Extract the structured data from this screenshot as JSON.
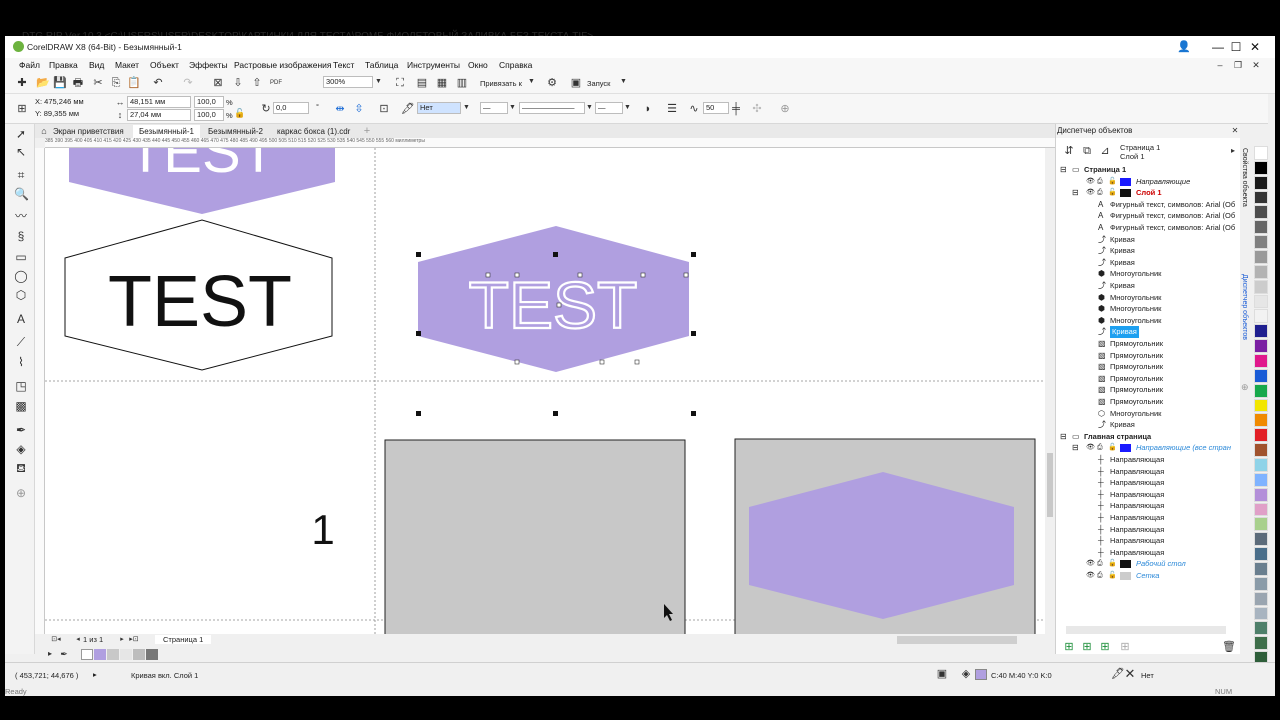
{
  "topbar": {
    "ghost_title": "DTG RIP Ver.10.3 <C:\\USERS\\USER\\DESKTOP\\КАРТИНКИ ДЛЯ ТЕСТА\\РОМБ ФИОЛЕТОВЫЙ ЗАЛИВКА БЕЗ ТЕКСТА.TIF>"
  },
  "window": {
    "title": "CorelDRAW X8 (64-Bit) - Безымянный-1",
    "minimize": "—",
    "maximize": "☐",
    "close": "✕",
    "min_inner": "–",
    "max_inner": "❐",
    "close_inner": "✕"
  },
  "menu": [
    "Файл",
    "Правка",
    "Вид",
    "Макет",
    "Объект",
    "Эффекты",
    "Растровые изображения",
    "Текст",
    "Таблица",
    "Инструменты",
    "Окно",
    "Справка"
  ],
  "toolbar": {
    "zoom": "300%",
    "snap_label": "Привязать к",
    "launch_label": "Запуск"
  },
  "props": {
    "x": "X: 475,246 мм",
    "y": "Y: 89,355 мм",
    "w": "48,151 мм",
    "h": "27,04 мм",
    "sx": "100,0",
    "sy": "100,0",
    "pct": "%",
    "angle": "0,0",
    "degree": "°",
    "fill_none": "Нет",
    "smooth_val": "50"
  },
  "doc_tabs": [
    "Экран приветствия",
    "Безымянный-1",
    "Безымянный-2",
    "каркас бокса (1).cdr"
  ],
  "ruler_h": "385   390   395   400   405   410   415   420   425   430   435   440   445   450   455   460   465   470   475   480   485   490   495   500   505   510   515   520   525   530   535   540   545   550   555   560   миллиметры",
  "canvas": {
    "top_test": "TEST",
    "hex_test": "TEST",
    "purple_test": "TEST",
    "page_number": "1",
    "purple": "#b09fe0"
  },
  "page_nav": {
    "pages": "1  из  1",
    "page_tab": "Страница 1"
  },
  "docker": {
    "title": "Диспетчер объектов",
    "page": "Страница 1",
    "layer": "Слой 1",
    "rows": [
      {
        "text": "Страница 1",
        "indent": 0,
        "style": "bold"
      },
      {
        "text": "Направляющие",
        "indent": 1,
        "style": "italic",
        "swatch": "#1a1aff"
      },
      {
        "text": "Слой 1",
        "indent": 1,
        "style": "boldred",
        "swatch": "#111111"
      },
      {
        "text": "Фигурный текст, символов: Arial (Об",
        "indent": 2,
        "icon": "A"
      },
      {
        "text": "Фигурный текст, символов: Arial (Об",
        "indent": 2,
        "icon": "A"
      },
      {
        "text": "Фигурный текст, символов: Arial (Об",
        "indent": 2,
        "icon": "A"
      },
      {
        "text": "Кривая",
        "indent": 2,
        "icon": "curve"
      },
      {
        "text": "Кривая",
        "indent": 2,
        "icon": "curve"
      },
      {
        "text": "Кривая",
        "indent": 2,
        "icon": "curve"
      },
      {
        "text": "Многоугольник",
        "indent": 2,
        "icon": "poly"
      },
      {
        "text": "Кривая",
        "indent": 2,
        "icon": "curve"
      },
      {
        "text": "Многоугольник",
        "indent": 2,
        "icon": "poly"
      },
      {
        "text": "Многоугольник",
        "indent": 2,
        "icon": "poly"
      },
      {
        "text": "Многоугольник",
        "indent": 2,
        "icon": "poly"
      },
      {
        "text": "Кривая",
        "indent": 2,
        "icon": "curve",
        "selected": true
      },
      {
        "text": "Прямоугольник",
        "indent": 2,
        "icon": "rect"
      },
      {
        "text": "Прямоугольник",
        "indent": 2,
        "icon": "rect"
      },
      {
        "text": "Прямоугольник",
        "indent": 2,
        "icon": "rect"
      },
      {
        "text": "Прямоугольник",
        "indent": 2,
        "icon": "rect"
      },
      {
        "text": "Прямоугольник",
        "indent": 2,
        "icon": "rect"
      },
      {
        "text": "Прямоугольник",
        "indent": 2,
        "icon": "rect"
      },
      {
        "text": "Многоугольник",
        "indent": 2,
        "icon": "polyo"
      },
      {
        "text": "Кривая",
        "indent": 2,
        "icon": "curve"
      },
      {
        "text": "Главная страница",
        "indent": 0,
        "style": "bold"
      },
      {
        "text": "Направляющие (все стран",
        "indent": 1,
        "style": "italicblue",
        "swatch": "#1a1aff"
      },
      {
        "text": "Направляющая",
        "indent": 2,
        "icon": "guide"
      },
      {
        "text": "Направляющая",
        "indent": 2,
        "icon": "guide"
      },
      {
        "text": "Направляющая",
        "indent": 2,
        "icon": "guide"
      },
      {
        "text": "Направляющая",
        "indent": 2,
        "icon": "guide"
      },
      {
        "text": "Направляющая",
        "indent": 2,
        "icon": "guide"
      },
      {
        "text": "Направляющая",
        "indent": 2,
        "icon": "guide"
      },
      {
        "text": "Направляющая",
        "indent": 2,
        "icon": "guide"
      },
      {
        "text": "Направляющая",
        "indent": 2,
        "icon": "guide"
      },
      {
        "text": "Направляющая",
        "indent": 2,
        "icon": "guide"
      },
      {
        "text": "Рабочий стол",
        "indent": 1,
        "style": "italicblue",
        "swatch": "#111111"
      },
      {
        "text": "Сетка",
        "indent": 1,
        "style": "italicblue",
        "swatch": "#cccccc"
      }
    ]
  },
  "side_tabs": [
    "Свойства объекта",
    "Диспетчер объектов"
  ],
  "palette": [
    "#ffffff",
    "#000000",
    "#1a1a1a",
    "#333333",
    "#4d4d4d",
    "#666666",
    "#808080",
    "#999999",
    "#b3b3b3",
    "#cccccc",
    "#e6e6e6",
    "#f2f2f2",
    "#1f1f8f",
    "#7a1fa2",
    "#e0188c",
    "#1a5cd6",
    "#17a84b",
    "#f2e600",
    "#f08a00",
    "#e21f26",
    "#a0522d",
    "#8fd3e8",
    "#7fb3ff",
    "#b38fd9",
    "#e0a0c8",
    "#a8d08d",
    "#5c6b7a",
    "#4a6e8a",
    "#6a7f8f",
    "#8a9ba8",
    "#9aa5b0",
    "#a8b4c0",
    "#4e7f6a",
    "#3e6e4a",
    "#2e5e3a"
  ],
  "statusbar": {
    "coords": "( 453,721; 44,676 )",
    "status": "Кривая вкл. Слой 1",
    "fill_info": "C:40 M:40 Y:0 K:0",
    "outline": "Нет"
  },
  "bottom": {
    "ready": "Ready",
    "num": "NUM"
  }
}
